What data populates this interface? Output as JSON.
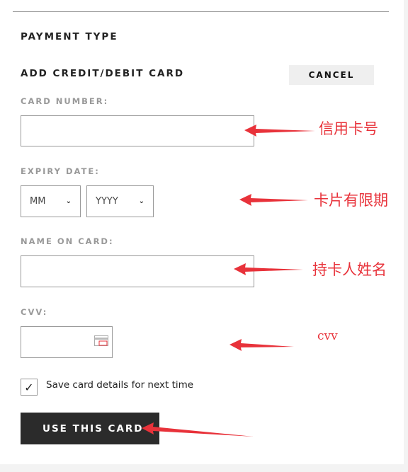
{
  "section_title": "PAYMENT TYPE",
  "form": {
    "title": "ADD CREDIT/DEBIT CARD",
    "cancel_label": "CANCEL",
    "card_number_label": "CARD NUMBER:",
    "card_number_value": "",
    "expiry_label": "EXPIRY DATE:",
    "month_selected": "MM",
    "year_selected": "YYYY",
    "name_label": "NAME ON CARD:",
    "name_value": "",
    "cvv_label": "CVV:",
    "cvv_value": "",
    "save_card_label": "Save card details for next time",
    "save_card_checked": true,
    "submit_label": "USE THIS CARD"
  },
  "annotations": {
    "card_number": "信用卡号",
    "expiry": "卡片有限期",
    "name": "持卡人姓名",
    "cvv": "cvv",
    "color": "#e8323a"
  }
}
